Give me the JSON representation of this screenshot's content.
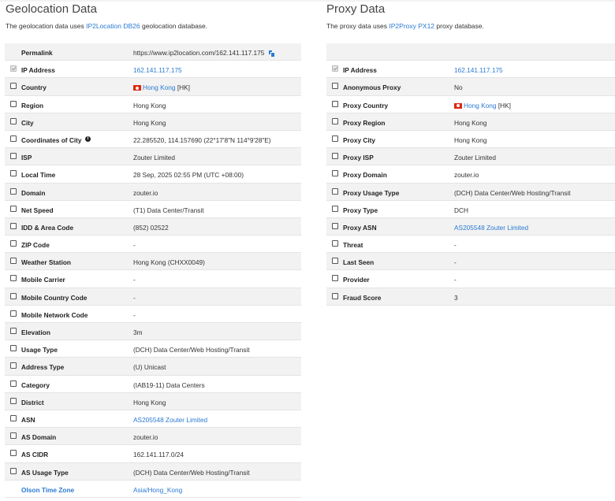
{
  "geo": {
    "title": "Geolocation Data",
    "intro_prefix": "The geolocation data uses ",
    "intro_link": "IP2Location DB26",
    "intro_suffix": " geolocation database.",
    "permalink": {
      "label": "Permalink",
      "value": "https://www.ip2location.com/162.141.117.175"
    },
    "rows": [
      {
        "label": "IP Address",
        "value": "162.141.117.175",
        "link": true,
        "checked": true
      },
      {
        "label": "Country",
        "value": "Hong Kong",
        "link": true,
        "flag": true,
        "suffix": " [HK]"
      },
      {
        "label": "Region",
        "value": "Hong Kong"
      },
      {
        "label": "City",
        "value": "Hong Kong"
      },
      {
        "label": "Coordinates of City",
        "value": "22.285520, 114.157690 (22°17'8\"N   114°9'28\"E)",
        "info": true
      },
      {
        "label": "ISP",
        "value": "Zouter Limited"
      },
      {
        "label": "Local Time",
        "value": "28 Sep, 2025 02:55 PM (UTC +08:00)"
      },
      {
        "label": "Domain",
        "value": "zouter.io"
      },
      {
        "label": "Net Speed",
        "value": "(T1) Data Center/Transit"
      },
      {
        "label": "IDD & Area Code",
        "value": "(852) 02522"
      },
      {
        "label": "ZIP Code",
        "value": "-"
      },
      {
        "label": "Weather Station",
        "value": "Hong Kong (CHXX0049)"
      },
      {
        "label": "Mobile Carrier",
        "value": "-"
      },
      {
        "label": "Mobile Country Code",
        "value": "-"
      },
      {
        "label": "Mobile Network Code",
        "value": "-"
      },
      {
        "label": "Elevation",
        "value": "3m"
      },
      {
        "label": "Usage Type",
        "value": "(DCH) Data Center/Web Hosting/Transit"
      },
      {
        "label": "Address Type",
        "value": "(U) Unicast"
      },
      {
        "label": "Category",
        "value": "(IAB19-11) Data Centers"
      },
      {
        "label": "District",
        "value": "Hong Kong"
      },
      {
        "label": "ASN",
        "value": "AS205548 Zouter Limited",
        "link": true
      },
      {
        "label": "AS Domain",
        "value": "zouter.io"
      },
      {
        "label": "AS CIDR",
        "value": "162.141.117.0/24"
      },
      {
        "label": "AS Usage Type",
        "value": "(DCH) Data Center/Web Hosting/Transit"
      },
      {
        "label": "Olson Time Zone",
        "value": "Asia/Hong_Kong",
        "link": true,
        "nocheck": true,
        "blueLabel": true
      }
    ]
  },
  "proxy": {
    "title": "Proxy Data",
    "intro_prefix": "The proxy data uses ",
    "intro_link": "IP2Proxy PX12",
    "intro_suffix": " proxy database.",
    "rows": [
      {
        "label": "IP Address",
        "value": "162.141.117.175",
        "link": true,
        "checked": true
      },
      {
        "label": "Anonymous Proxy",
        "value": "No"
      },
      {
        "label": "Proxy Country",
        "value": "Hong Kong",
        "link": true,
        "flag": true,
        "suffix": " [HK]"
      },
      {
        "label": "Proxy Region",
        "value": "Hong Kong"
      },
      {
        "label": "Proxy City",
        "value": "Hong Kong"
      },
      {
        "label": "Proxy ISP",
        "value": "Zouter Limited"
      },
      {
        "label": "Proxy Domain",
        "value": "zouter.io"
      },
      {
        "label": "Proxy Usage Type",
        "value": "(DCH) Data Center/Web Hosting/Transit"
      },
      {
        "label": "Proxy Type",
        "value": "DCH"
      },
      {
        "label": "Proxy ASN",
        "value": "AS205548 Zouter Limited",
        "link": true
      },
      {
        "label": "Threat",
        "value": "-"
      },
      {
        "label": "Last Seen",
        "value": "-"
      },
      {
        "label": "Provider",
        "value": "-"
      },
      {
        "label": "Fraud Score",
        "value": "3"
      }
    ]
  },
  "colors": {
    "link": "#2a7ad3",
    "row_shade": "#f2f2f2",
    "flag_red": "#de2910"
  }
}
